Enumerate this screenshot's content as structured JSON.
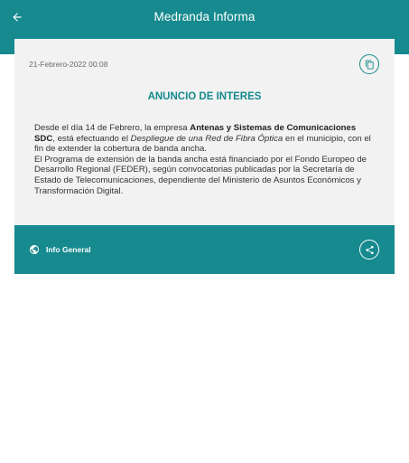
{
  "header": {
    "title": "Medranda Informa",
    "back_icon": "arrow-left-icon"
  },
  "card": {
    "date": "21-Febrero-2022 00:08",
    "copy_icon": "copy-icon",
    "headline": "ANUNCIO DE INTERES",
    "body": {
      "p1_a": "Desde el día 14 de Febrero, la empresa ",
      "p1_bold": "Antenas y Sistemas de Comunicaciones SDC",
      "p1_b": ", está efectuando el ",
      "p1_italic": "Despliegue de una Red de Fibra Óptica",
      "p1_c": " en el municipio, con el fin de extender la cobertura de banda ancha.",
      "p2": "El Programa de extensión de la banda ancha está financiado por  el Fondo Europeo de Desarrollo Regional (FEDER), según convocatorias publicadas por la Secretaría de Estado de Telecomunicaciones, dependiente del Ministerio de Asuntos Económicos y Transformación Digital."
    }
  },
  "footer": {
    "category": "Info General",
    "category_icon": "globe-icon",
    "share_icon": "share-icon"
  },
  "colors": {
    "primary": "#168a8e",
    "card_bg": "#f2f2f2"
  }
}
